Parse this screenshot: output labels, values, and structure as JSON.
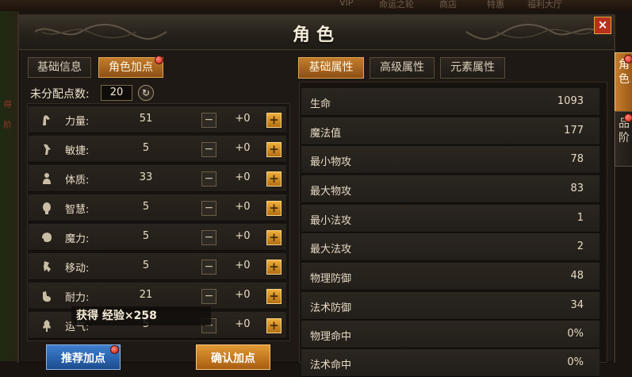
{
  "top_strip": [
    "VIP",
    "命运之轮",
    "商店",
    "特惠",
    "福利大厅"
  ],
  "left_edge_text": [
    "得",
    "阶"
  ],
  "window": {
    "title": "角色",
    "close_label": "×"
  },
  "left_tabs": [
    {
      "label": "基础信息",
      "active": false
    },
    {
      "label": "角色加点",
      "active": true
    }
  ],
  "unassigned": {
    "label": "未分配点数:",
    "value": "20",
    "refresh_icon": "↻"
  },
  "stats": [
    {
      "icon": "arm-icon",
      "label": "力量:",
      "value": "51",
      "bonus": "+0"
    },
    {
      "icon": "agility-icon",
      "label": "敏捷:",
      "value": "5",
      "bonus": "+0"
    },
    {
      "icon": "body-icon",
      "label": "体质:",
      "value": "33",
      "bonus": "+0"
    },
    {
      "icon": "wisdom-icon",
      "label": "智慧:",
      "value": "5",
      "bonus": "+0"
    },
    {
      "icon": "magic-icon",
      "label": "魔力:",
      "value": "5",
      "bonus": "+0"
    },
    {
      "icon": "move-icon",
      "label": "移动:",
      "value": "5",
      "bonus": "+0"
    },
    {
      "icon": "stamina-icon",
      "label": "耐力:",
      "value": "21",
      "bonus": "+0"
    },
    {
      "icon": "luck-icon",
      "label": "运气:",
      "value": "5",
      "bonus": "+0"
    }
  ],
  "minus_label": "−",
  "plus_label": "+",
  "toast": "获得 经验×258",
  "buttons": {
    "recommend": "推荐加点",
    "confirm": "确认加点"
  },
  "right_tabs": [
    {
      "label": "基础属性",
      "active": true
    },
    {
      "label": "高级属性",
      "active": false
    },
    {
      "label": "元素属性",
      "active": false
    }
  ],
  "attributes": [
    {
      "label": "生命",
      "value": "1093"
    },
    {
      "label": "魔法值",
      "value": "177"
    },
    {
      "label": "最小物攻",
      "value": "78"
    },
    {
      "label": "最大物攻",
      "value": "83"
    },
    {
      "label": "最小法攻",
      "value": "1"
    },
    {
      "label": "最大法攻",
      "value": "2"
    },
    {
      "label": "物理防御",
      "value": "48"
    },
    {
      "label": "法术防御",
      "value": "34"
    },
    {
      "label": "物理命中",
      "value": "0%"
    },
    {
      "label": "法术命中",
      "value": "0%"
    }
  ],
  "side_tabs": [
    {
      "label": "角色",
      "active": true
    },
    {
      "label": "品阶",
      "active": false
    }
  ],
  "colors": {
    "accent": "#c47d2c",
    "panel": "#1e1914",
    "alert_dot": "#c4160c"
  }
}
